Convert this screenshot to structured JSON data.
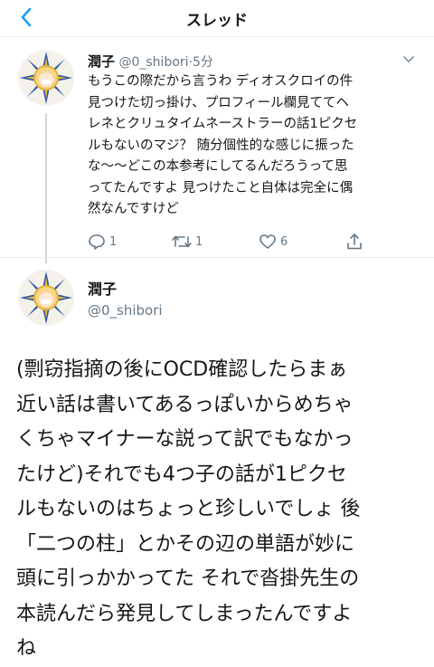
{
  "nav": {
    "title": "スレッド",
    "back_icon": "chevron-left-icon"
  },
  "reply_tweet": {
    "author_name": "潤子",
    "handle": "@0_shibori",
    "dot": "·",
    "time": "5分",
    "lines": [
      "もうこの際だから言うわ ディオスクロイの件",
      "見つけた切っ掛け、プロフィール欄見ててヘ",
      "レネとクリュタイムネーストラーの話1ピクセ",
      "ルもないのマジ？ 随分個性的な感じに振った",
      "な〜〜どこの本参考にしてるんだろうって思",
      "ってたんですよ 見つけたこと自体は完全に偶",
      "然なんですけど"
    ],
    "reply_count": "1",
    "retweet_count": "1",
    "like_count": "6"
  },
  "main_tweet": {
    "author_name": "潤子",
    "handle": "@0_shibori",
    "lines": [
      "(剽窃指摘の後にOCD確認したらまぁ",
      "近い話は書いてあるっぽいからめちゃ",
      "くちゃマイナーな説って訳でもなかっ",
      "たけど)それでも4つ子の話が1ピクセ",
      "ルもないのはちょっと珍しいでしょ 後",
      "「二つの柱」とかその辺の単語が妙に",
      "頭に引っかかってた それで沓掛先生の",
      "本読んだら発見してしまったんですよ",
      "ね"
    ]
  },
  "colors": {
    "accent": "#1da1f2",
    "muted": "#657786",
    "divider": "#e6ecf0"
  }
}
